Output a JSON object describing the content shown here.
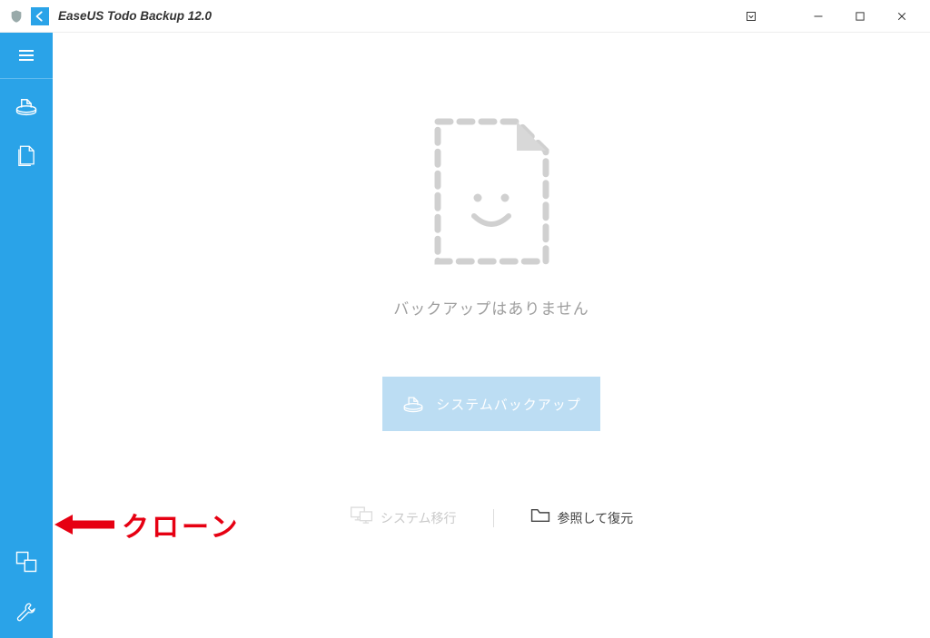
{
  "titlebar": {
    "title": "EaseUS Todo Backup 12.0"
  },
  "main": {
    "empty_message": "バックアップはありません",
    "primary_button_label": "システムバックアップ",
    "links": {
      "system_transfer": "システム移行",
      "browse_restore": "参照して復元"
    }
  },
  "annotation": {
    "label": "クローン"
  },
  "colors": {
    "accent": "#2aa3e8",
    "primary_btn_bg": "#bcddf3",
    "annotation_red": "#e60012"
  }
}
